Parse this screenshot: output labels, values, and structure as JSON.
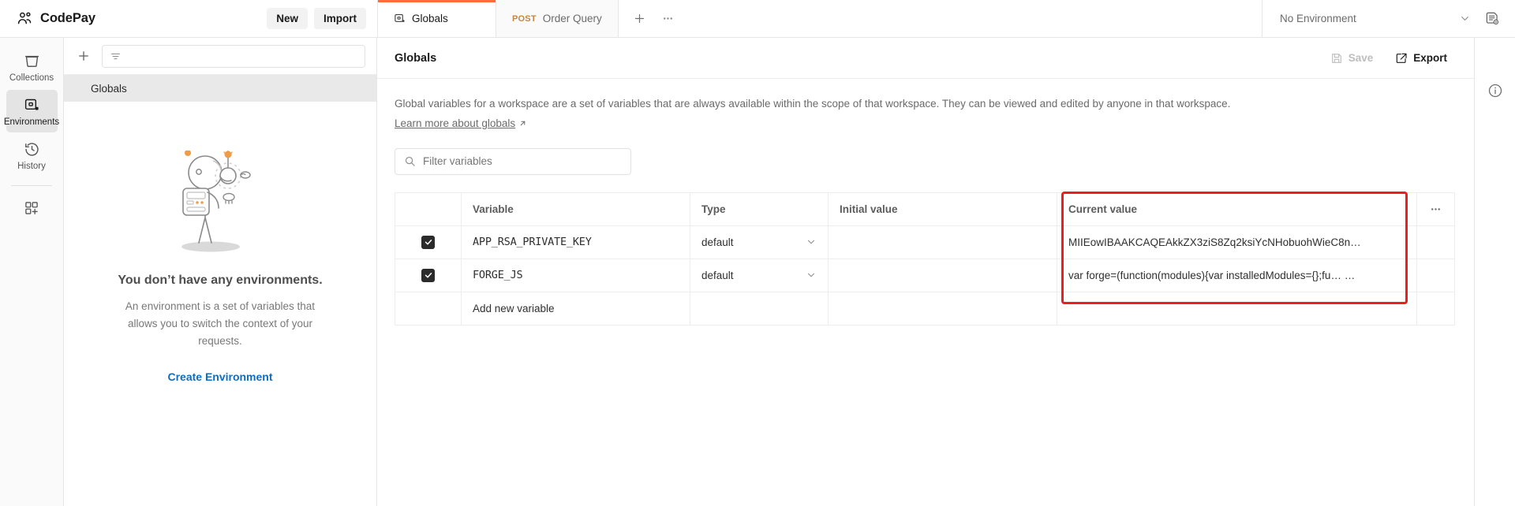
{
  "topbar": {
    "workspace_name": "CodePay",
    "workspace_icon": "users-icon",
    "new_label": "New",
    "import_label": "Import",
    "tabs": [
      {
        "label": "Globals",
        "method": "",
        "icon": "environment-icon",
        "active": true
      },
      {
        "label": "Order Query",
        "method": "POST",
        "icon": "",
        "active": false
      }
    ],
    "new_tab_icon": "plus-icon",
    "tab_more_icon": "ellipsis-icon",
    "environment_selected": "No Environment",
    "environment_chevron_icon": "chevron-down-icon",
    "env_quick_look_icon": "environment-quick-look-icon"
  },
  "rail": {
    "items": [
      {
        "label": "Collections",
        "icon": "collections-icon",
        "active": false
      },
      {
        "label": "Environments",
        "icon": "environments-icon",
        "active": true
      },
      {
        "label": "History",
        "icon": "history-icon",
        "active": false
      }
    ],
    "apps_icon": "add-apps-icon"
  },
  "sidebar": {
    "create_icon": "plus-icon",
    "filter_icon": "filter-icon",
    "filter_placeholder": "",
    "list": [
      {
        "label": "Globals",
        "selected": true
      }
    ],
    "empty_state": {
      "illustration": "astronaut-illustration",
      "title": "You don’t have any environments.",
      "description": "An environment is a set of variables that allows you to switch the context of your requests.",
      "cta_label": "Create Environment"
    }
  },
  "main": {
    "title": "Globals",
    "save_label": "Save",
    "save_icon": "save-icon",
    "save_disabled": true,
    "export_label": "Export",
    "export_icon": "export-icon",
    "description": "Global variables for a workspace are a set of variables that are always available within the scope of that workspace. They can be viewed and edited by anyone in that workspace.",
    "learn_more_label": "Learn more about globals",
    "learn_more_icon": "external-link-icon",
    "filter_placeholder": "Filter variables",
    "filter_value": "",
    "filter_icon": "search-icon",
    "table": {
      "headers": [
        "",
        "Variable",
        "Type",
        "Initial value",
        "Current value",
        ""
      ],
      "more_icon": "ellipsis-icon",
      "rows": [
        {
          "checked": true,
          "variable": "APP_RSA_PRIVATE_KEY",
          "type": "default",
          "initial_value": "",
          "current_value": "MIIEowIBAAKCAQEAkkZX3ziS8Zq2ksiYcNHobuohWieC8n…"
        },
        {
          "checked": true,
          "variable": "FORGE_JS",
          "type": "default",
          "initial_value": "",
          "current_value": "var forge=(function(modules){var installedModules={};fu… …"
        }
      ],
      "add_row_placeholder": "Add new variable",
      "type_chevron_icon": "chevron-down-icon"
    },
    "highlight_color": "#f01d1d"
  },
  "right_rail": {
    "info_icon": "info-icon"
  }
}
